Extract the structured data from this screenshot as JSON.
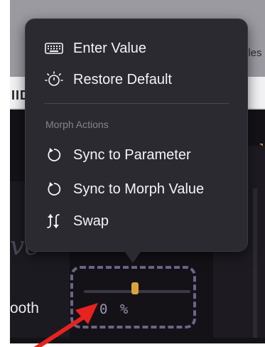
{
  "background": {
    "band_text": "IID",
    "files_text": "iles",
    "orange_text": "rpl",
    "left_label_partial": "ve",
    "row_label": "ooth",
    "value_display": "0 %"
  },
  "menu": {
    "items": [
      {
        "label": "Enter Value",
        "icon": "keyboard-icon"
      },
      {
        "label": "Restore Default",
        "icon": "restore-icon"
      }
    ],
    "section_title": "Morph Actions",
    "morph_items": [
      {
        "label": "Sync to Parameter",
        "icon": "sync-icon"
      },
      {
        "label": "Sync to Morph Value",
        "icon": "sync-icon"
      },
      {
        "label": "Swap",
        "icon": "swap-icon"
      }
    ]
  },
  "colors": {
    "menu_bg": "#2b2a30",
    "accent": "#d9a53a",
    "arrow": "#e8231f",
    "dashed_border": "#6b6686"
  },
  "slider": {
    "value_percent": 0
  }
}
